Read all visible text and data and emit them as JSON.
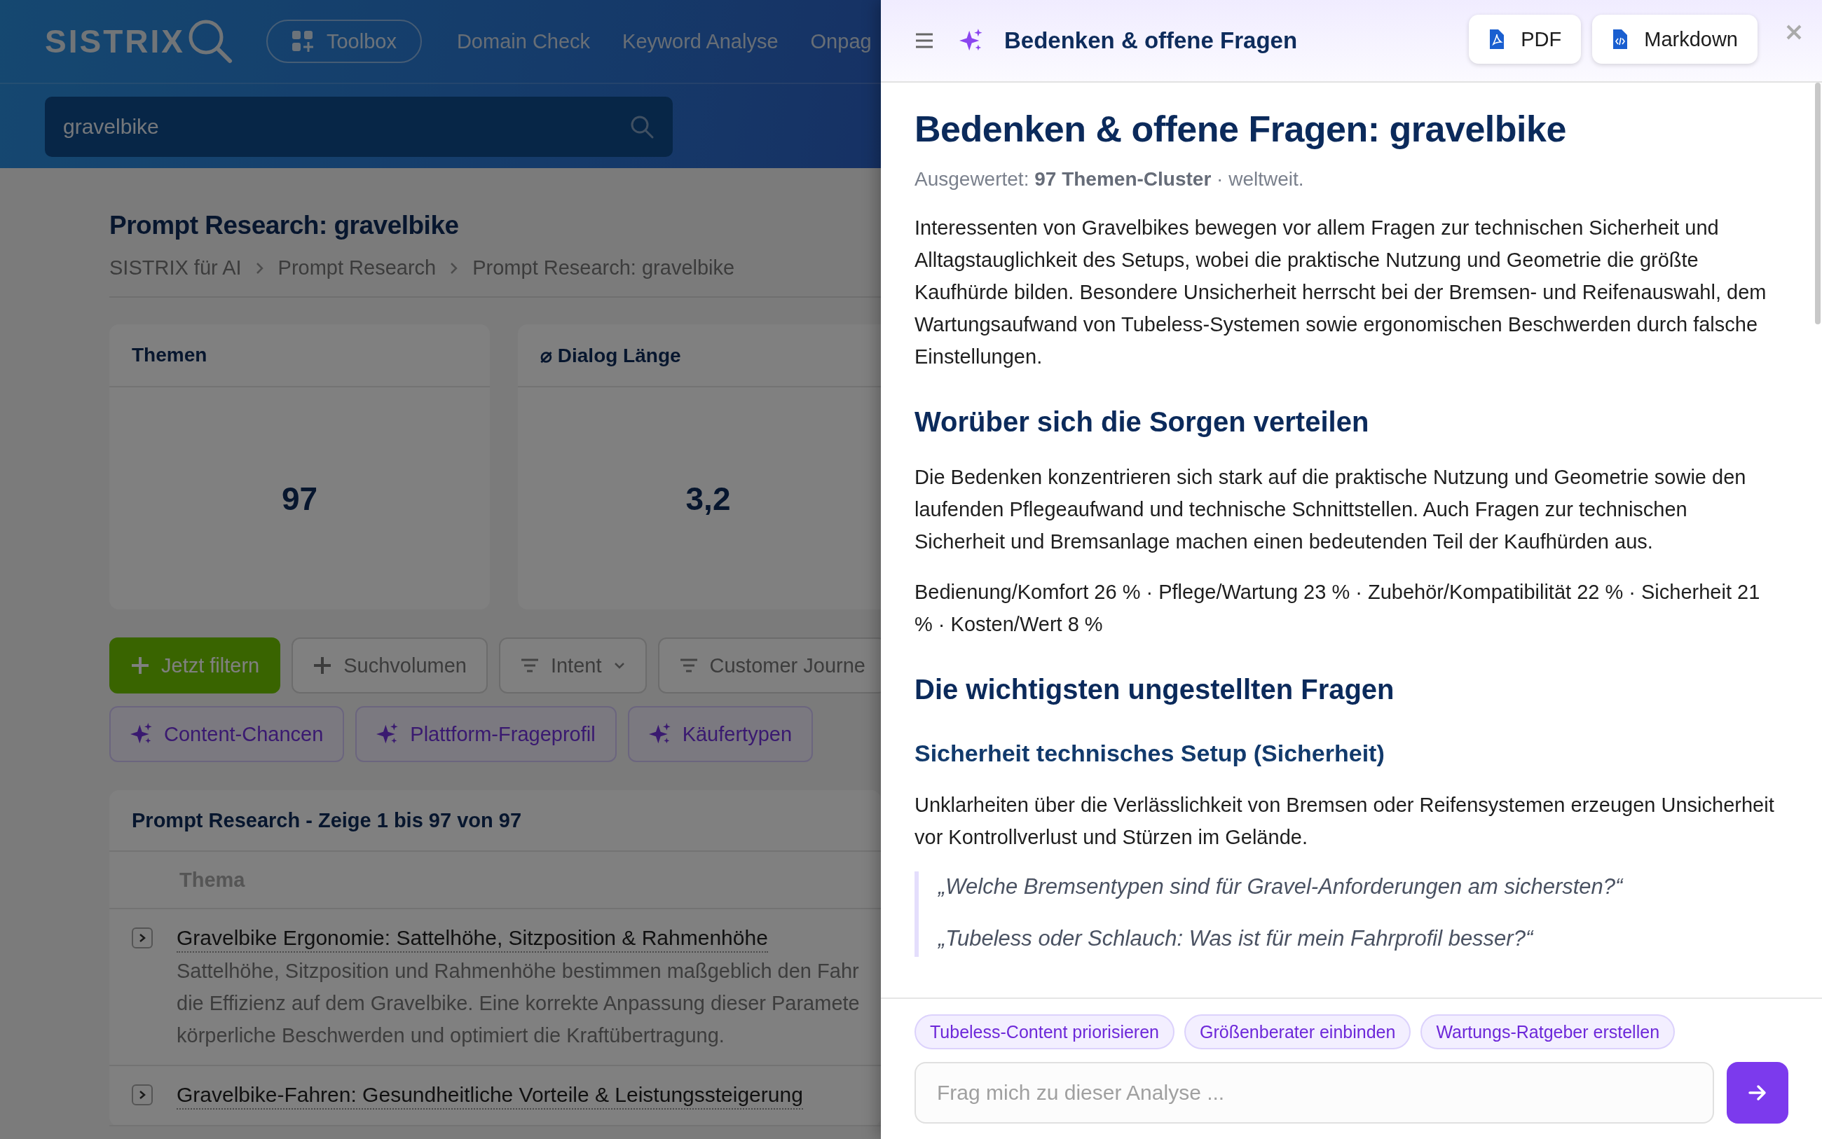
{
  "header": {
    "logo": "SISTRIX",
    "nav": [
      {
        "label": "Toolbox",
        "kind": "pill"
      },
      {
        "label": "Domain Check",
        "kind": "link"
      },
      {
        "label": "Keyword Analyse",
        "kind": "link"
      },
      {
        "label": "Onpag",
        "kind": "link"
      }
    ],
    "search": {
      "value": "gravelbike"
    }
  },
  "page": {
    "title": "Prompt Research: gravelbike",
    "breadcrumbs": [
      "SISTRIX für AI",
      "Prompt Research",
      "Prompt Research: gravelbike"
    ],
    "cards": [
      {
        "title": "Themen",
        "value": "97"
      },
      {
        "title": "⌀ Dialog Länge",
        "value": "3,2"
      }
    ],
    "filters": [
      {
        "label": "Jetzt filtern",
        "kind": "primary"
      },
      {
        "label": "Suchvolumen",
        "kind": "add"
      },
      {
        "label": "Intent",
        "kind": "dropdown"
      },
      {
        "label": "Customer Journe",
        "kind": "filter"
      }
    ],
    "ai_chips": [
      "Content-Chancen",
      "Plattform-Frageprofil",
      "Käufertypen"
    ],
    "table": {
      "title": "Prompt Research - Zeige 1 bis 97 von 97",
      "columns": [
        "Thema"
      ],
      "rows": [
        {
          "title": "Gravelbike Ergonomie: Sattelhöhe, Sitzposition & Rahmenhöhe",
          "description": [
            "Sattelhöhe, Sitzposition und Rahmenhöhe bestimmen maßgeblich den Fahr",
            "die Effizienz auf dem Gravelbike. Eine korrekte Anpassung dieser Paramete",
            "körperliche Beschwerden und optimiert die Kraftübertragung."
          ]
        },
        {
          "title": "Gravelbike-Fahren: Gesundheitliche Vorteile & Leistungssteigerung",
          "description": []
        }
      ]
    }
  },
  "panel": {
    "title": "Bedenken & offene Fragen",
    "exports": [
      {
        "label": "PDF",
        "kind": "pdf"
      },
      {
        "label": "Markdown",
        "kind": "markdown"
      }
    ],
    "content": [
      {
        "kind": "h1",
        "text": "Bedenken & offene Fragen: gravelbike"
      },
      {
        "kind": "meta",
        "text": "Ausgewertet: **97 Themen-Cluster** · weltweit."
      },
      {
        "kind": "p",
        "text": "Interessenten von Gravelbikes bewegen vor allem Fragen zur technischen Sicherheit und Alltagstauglichkeit des Setups, wobei die praktische Nutzung und Geometrie die größte Kaufhürde bilden. Besondere Unsicherheit herrscht bei der Bremsen- und Reifenauswahl, dem Wartungsaufwand von Tubeless-Systemen sowie ergonomischen Beschwerden durch falsche Einstellungen."
      },
      {
        "kind": "h2",
        "text": "Worüber sich die Sorgen verteilen"
      },
      {
        "kind": "p",
        "text": "Die Bedenken konzentrieren sich stark auf die praktische Nutzung und Geometrie sowie den laufenden Pflegeaufwand und technische Schnittstellen. Auch Fragen zur technischen Sicherheit und Bremsanlage machen einen bedeutenden Teil der Kaufhürden aus."
      },
      {
        "kind": "p",
        "text": "Bedienung/Komfort 26 % · Pflege/Wartung 23 % · Zubehör/Kompatibilität 22 % · Sicherheit 21 % · Kosten/Wert 8 %"
      },
      {
        "kind": "h2",
        "text": "Die wichtigsten ungestellten Fragen"
      },
      {
        "kind": "h3",
        "text": "Sicherheit technisches Setup (Sicherheit)"
      },
      {
        "kind": "p",
        "text": "Unklarheiten über die Verlässlichkeit von Bremsen oder Reifensystemen erzeugen Unsicherheit vor Kontrollverlust und Stürzen im Gelände."
      },
      {
        "kind": "quote",
        "items": [
          "„Welche Bremsentypen sind für Gravel-Anforderungen am sichersten?“",
          "„Tubeless oder Schlauch: Was ist für mein Fahrprofil besser?“"
        ]
      }
    ],
    "suggestions": [
      "Tubeless-Content priorisieren",
      "Größenberater einbinden",
      "Wartungs-Ratgeber erstellen"
    ],
    "input": {
      "placeholder": "Frag mich zu dieser Analyse ..."
    }
  }
}
